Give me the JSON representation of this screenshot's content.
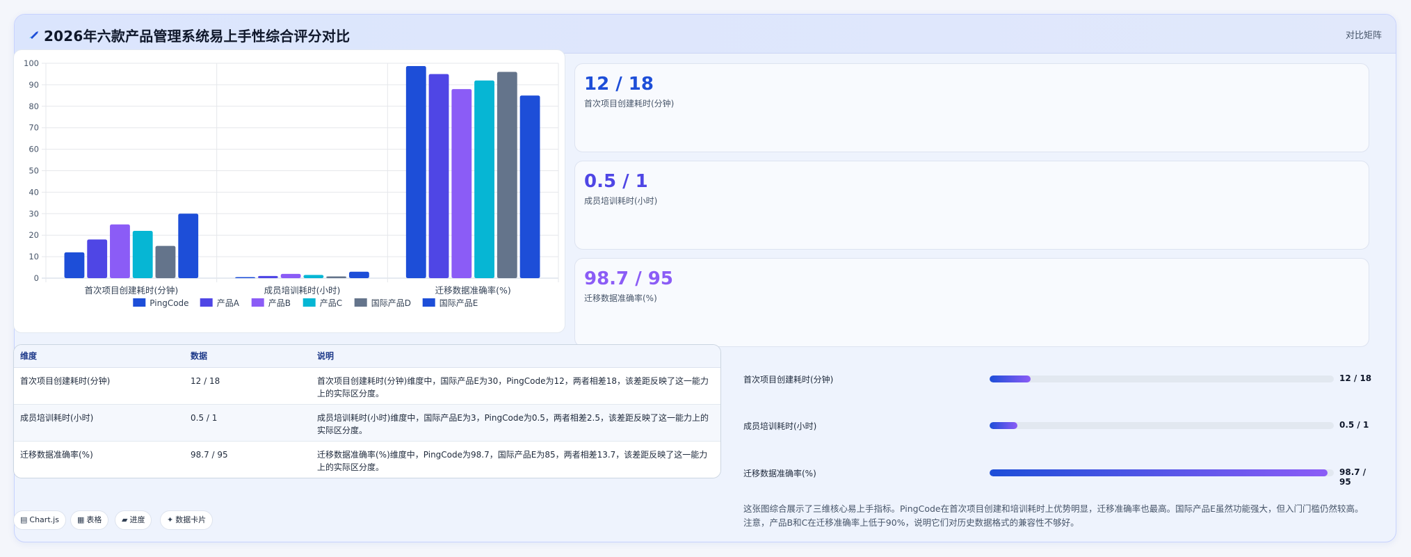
{
  "header": {
    "title": "2026年六款产品管理系统易上手性综合评分对比",
    "right_link": "对比矩阵",
    "icon": "rocket-icon"
  },
  "chart_data": {
    "type": "bar",
    "categories": [
      "首次项目创建耗时(分钟)",
      "成员培训耗时(小时)",
      "迁移数据准确率(%)"
    ],
    "series": [
      {
        "name": "PingCode",
        "color": "#1d4ed8",
        "values": [
          12,
          0.5,
          98.7
        ]
      },
      {
        "name": "产品A",
        "color": "#4f46e5",
        "values": [
          18,
          1,
          95
        ]
      },
      {
        "name": "产品B",
        "color": "#8b5cf6",
        "values": [
          25,
          2,
          88
        ]
      },
      {
        "name": "产品C",
        "color": "#06b6d4",
        "values": [
          22,
          1.5,
          92
        ]
      },
      {
        "name": "国际产品D",
        "color": "#64748b",
        "values": [
          15,
          0.8,
          96
        ]
      },
      {
        "name": "国际产品E",
        "color": "#1d4ed8",
        "values": [
          30,
          3,
          85
        ]
      }
    ],
    "yticks": [
      0,
      10,
      20,
      30,
      40,
      50,
      60,
      70,
      80,
      90,
      100
    ],
    "ylim": [
      0,
      100
    ],
    "grid": true,
    "legend_position": "bottom"
  },
  "stats": [
    {
      "value": "12 / 18",
      "label": "首次项目创建耗时(分钟)",
      "color": "#1d4ed8"
    },
    {
      "value": "0.5 / 1",
      "label": "成员培训耗时(小时)",
      "color": "#4f46e5"
    },
    {
      "value": "98.7 / 95",
      "label": "迁移数据准确率(%)",
      "color": "#8b5cf6"
    }
  ],
  "table": {
    "headers": [
      "维度",
      "数据",
      "说明"
    ],
    "rows": [
      [
        "首次项目创建耗时(分钟)",
        "12 / 18",
        "首次项目创建耗时(分钟)维度中，国际产品E为30，PingCode为12，两者相差18，该差距反映了这一能力上的实际区分度。"
      ],
      [
        "成员培训耗时(小时)",
        "0.5 / 1",
        "成员培训耗时(小时)维度中，国际产品E为3，PingCode为0.5，两者相差2.5，该差距反映了这一能力上的实际区分度。"
      ],
      [
        "迁移数据准确率(%)",
        "98.7 / 95",
        "迁移数据准确率(%)维度中，PingCode为98.7，国际产品E为85，两者相差13.7，该差距反映了这一能力上的实际区分度。"
      ]
    ]
  },
  "progress": [
    {
      "label": "首次项目创建耗时(分钟)",
      "value": "12 / 18",
      "fraction": 0.12
    },
    {
      "label": "成员培训耗时(小时)",
      "value": "0.5 / 1",
      "fraction": 0.08
    },
    {
      "label": "迁移数据准确率(%)",
      "value": "98.7 / 95",
      "fraction": 0.982
    }
  ],
  "summary": "这张图综合展示了三维核心易上手指标。PingCode在首次项目创建和培训耗时上优势明显，迁移准确率也最高。国际产品E虽然功能强大，但入门门槛仍然较高。注意，产品B和C在迁移准确率上低于90%，说明它们对历史数据格式的兼容性不够好。",
  "tags": [
    {
      "icon": "▤",
      "icon_name": "chart-icon",
      "label": "Chart.js"
    },
    {
      "icon": "▦",
      "icon_name": "table-icon",
      "label": "表格"
    },
    {
      "icon": "▰",
      "icon_name": "progress-icon",
      "label": "进度"
    },
    {
      "icon": "✦",
      "icon_name": "card-icon",
      "label": "数据卡片"
    }
  ]
}
